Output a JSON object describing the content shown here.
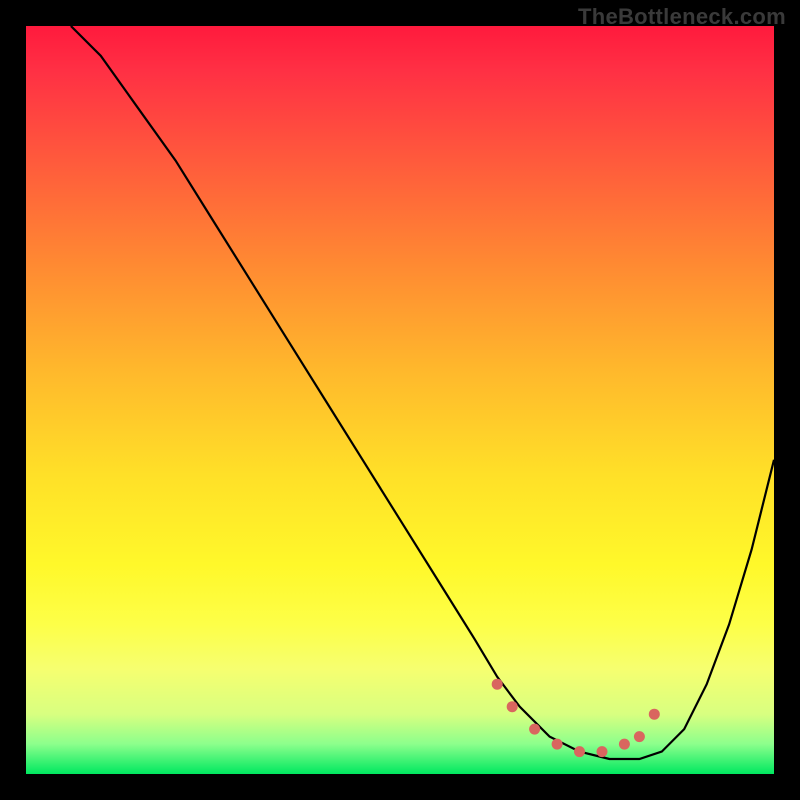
{
  "watermark": "TheBottleneck.com",
  "chart_data": {
    "type": "line",
    "title": "",
    "xlabel": "",
    "ylabel": "",
    "xlim": [
      0,
      100
    ],
    "ylim": [
      0,
      100
    ],
    "grid": false,
    "series": [
      {
        "name": "curve",
        "color": "#000000",
        "x": [
          6,
          10,
          15,
          20,
          25,
          30,
          35,
          40,
          45,
          50,
          55,
          60,
          63,
          66,
          70,
          74,
          78,
          82,
          85,
          88,
          91,
          94,
          97,
          100
        ],
        "y": [
          100,
          96,
          89,
          82,
          74,
          66,
          58,
          50,
          42,
          34,
          26,
          18,
          13,
          9,
          5,
          3,
          2,
          2,
          3,
          6,
          12,
          20,
          30,
          42
        ]
      },
      {
        "name": "markers",
        "color": "#d9665f",
        "x": [
          63,
          65,
          68,
          71,
          74,
          77,
          80,
          82,
          84
        ],
        "y": [
          12,
          9,
          6,
          4,
          3,
          3,
          4,
          5,
          8
        ]
      }
    ]
  }
}
